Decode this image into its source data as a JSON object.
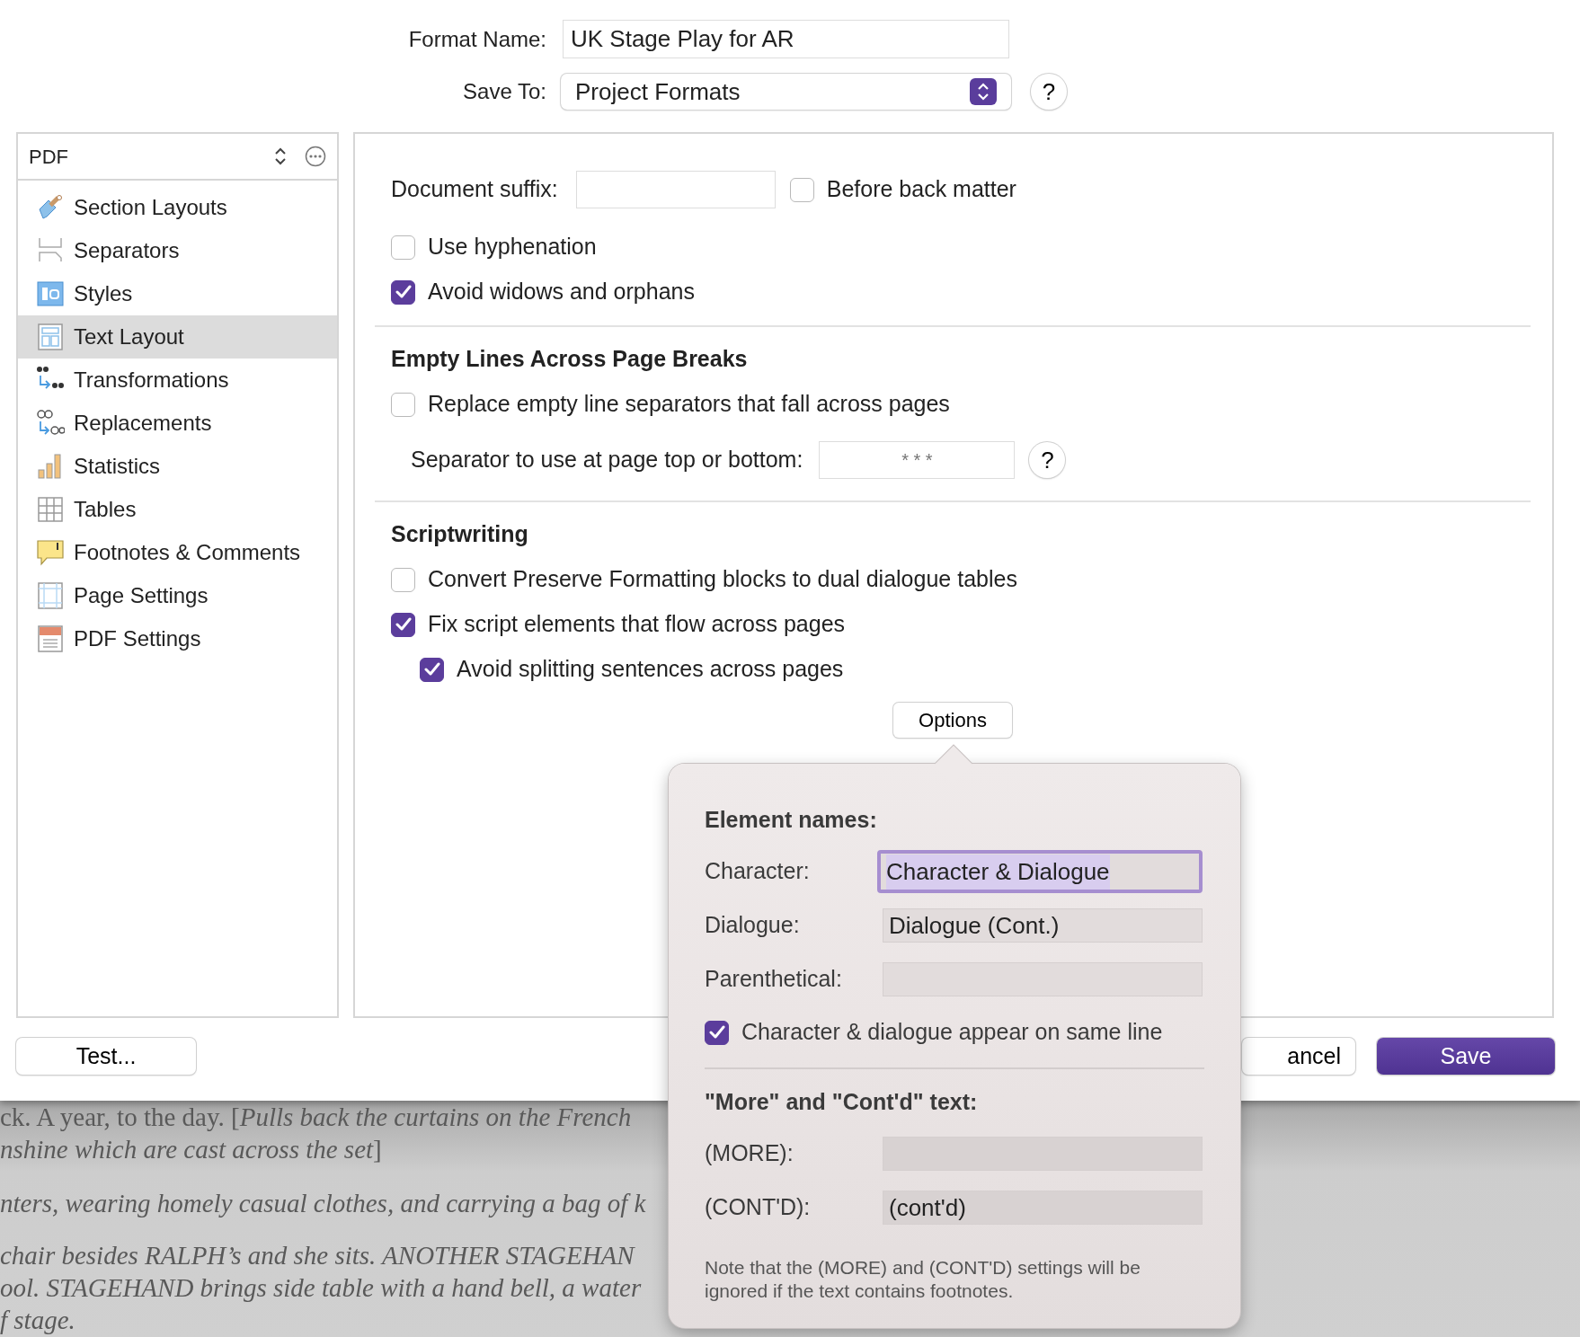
{
  "format_name": {
    "label": "Format Name:",
    "value": "UK Stage Play for AR"
  },
  "save_to": {
    "label": "Save To:",
    "value": "Project Formats",
    "help": "?"
  },
  "sidebar": {
    "title": "PDF",
    "items": [
      {
        "label": "Section Layouts",
        "kind": "brush",
        "selected": false
      },
      {
        "label": "Separators",
        "kind": "separator",
        "selected": false
      },
      {
        "label": "Styles",
        "kind": "styles",
        "selected": false
      },
      {
        "label": "Text Layout",
        "kind": "layout",
        "selected": true
      },
      {
        "label": "Transformations",
        "kind": "quotes",
        "selected": false
      },
      {
        "label": "Replacements",
        "kind": "replace",
        "selected": false
      },
      {
        "label": "Statistics",
        "kind": "stats",
        "selected": false
      },
      {
        "label": "Tables",
        "kind": "table",
        "selected": false
      },
      {
        "label": "Footnotes & Comments",
        "kind": "footnote",
        "selected": false
      },
      {
        "label": "Page Settings",
        "kind": "page",
        "selected": false
      },
      {
        "label": "PDF Settings",
        "kind": "pdf",
        "selected": false
      }
    ]
  },
  "settings": [
    {
      "kind": "suffix",
      "label": "Document suffix:",
      "option": {
        "label": "Before back matter",
        "checked": false
      }
    },
    {
      "kind": "checkbox",
      "label": "Use hyphenation",
      "checked": false
    },
    {
      "kind": "checkbox",
      "label": "Avoid widows and orphans",
      "checked": true
    },
    {
      "kind": "divider"
    },
    {
      "kind": "heading",
      "label": "Empty Lines Across Page Breaks"
    },
    {
      "kind": "checkbox",
      "label": "Replace empty line separators that fall across pages",
      "checked": false
    },
    {
      "kind": "separator_field",
      "label": "Separator to use at page top or bottom:",
      "placeholder": "* * *",
      "help": "?"
    },
    {
      "kind": "divider"
    },
    {
      "kind": "heading",
      "label": "Scriptwriting"
    },
    {
      "kind": "checkbox",
      "label": "Convert Preserve Formatting blocks to dual dialogue tables",
      "checked": false
    },
    {
      "kind": "checkbox",
      "label": "Fix script elements that flow across pages",
      "checked": true
    },
    {
      "kind": "sub_checkbox",
      "label": "Avoid splitting sentences across pages",
      "checked": true
    },
    {
      "kind": "button",
      "label": "Options"
    }
  ],
  "buttons": [
    {
      "label": "Test...",
      "kind": "plain"
    },
    {
      "label": "ancel",
      "kind": "plain"
    },
    {
      "label": "Save",
      "kind": "primary"
    }
  ],
  "document_lines": [
    "ck. A year, to the day. [*Pulls back the curtains on the French*",
    "*nshine which are cast across the set*]",
    "*nters, wearing homely casual clothes, and carrying a bag of k*",
    "*chair besides RALPH’s and she sits. ANOTHER STAGEHAN*",
    "*ool. STAGEHAND brings side table with a hand bell, a water*",
    "*f stage.*"
  ],
  "options_popover": {
    "sections": [
      {
        "title": "Element names:",
        "fields": [
          {
            "label": "Character:",
            "value": "Character & Dialogue",
            "focused": true
          },
          {
            "label": "Dialogue:",
            "value": "Dialogue (Cont.)",
            "focused": false
          },
          {
            "label": "Parenthetical:",
            "focused": false
          }
        ],
        "option": {
          "label": "Character & dialogue appear on same line",
          "checked": true
        }
      },
      {
        "title": "\"More\" and \"Cont'd\" text:",
        "fields": [
          {
            "label": "(MORE):",
            "focused": false
          },
          {
            "label": "(CONT'D):",
            "value": "(cont'd)",
            "focused": false
          }
        ]
      }
    ],
    "note": "Note that the (MORE) and (CONT'D) settings will be ignored if the text contains footnotes."
  }
}
